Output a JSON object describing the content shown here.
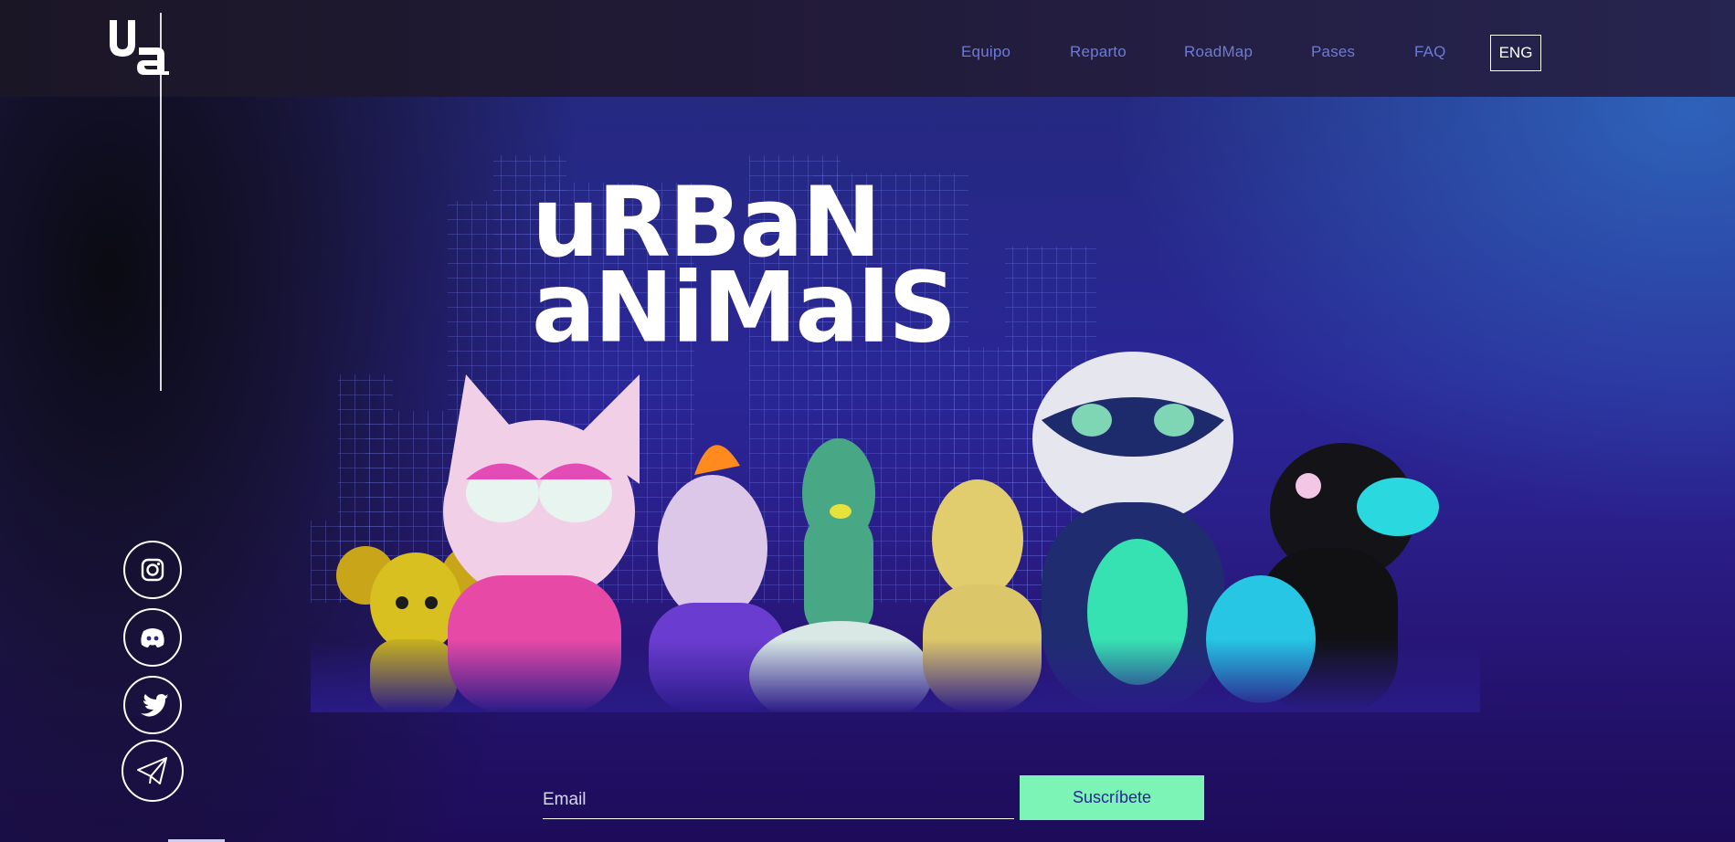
{
  "header": {
    "logo_alt": "ua",
    "nav": [
      "Equipo",
      "Reparto",
      "RoadMap",
      "Pases",
      "FAQ"
    ],
    "language_button": "ENG"
  },
  "hero": {
    "title_line1": "uRBaN",
    "title_line2": "aNiMalS",
    "characters": [
      "mouse",
      "cat",
      "cockatoo",
      "pigeon",
      "canary",
      "raccoon",
      "crow"
    ]
  },
  "socials": [
    {
      "name": "instagram-icon"
    },
    {
      "name": "discord-icon"
    },
    {
      "name": "twitter-icon"
    },
    {
      "name": "telegram-icon"
    }
  ],
  "newsletter": {
    "email_placeholder": "Email",
    "email_value": "",
    "subscribe_label": "Suscríbete"
  },
  "colors": {
    "accent_green": "#7cf4b5",
    "nav_text": "#6b7bd8",
    "background_blue": "#2a2696",
    "header_dark": "#1b1626"
  }
}
